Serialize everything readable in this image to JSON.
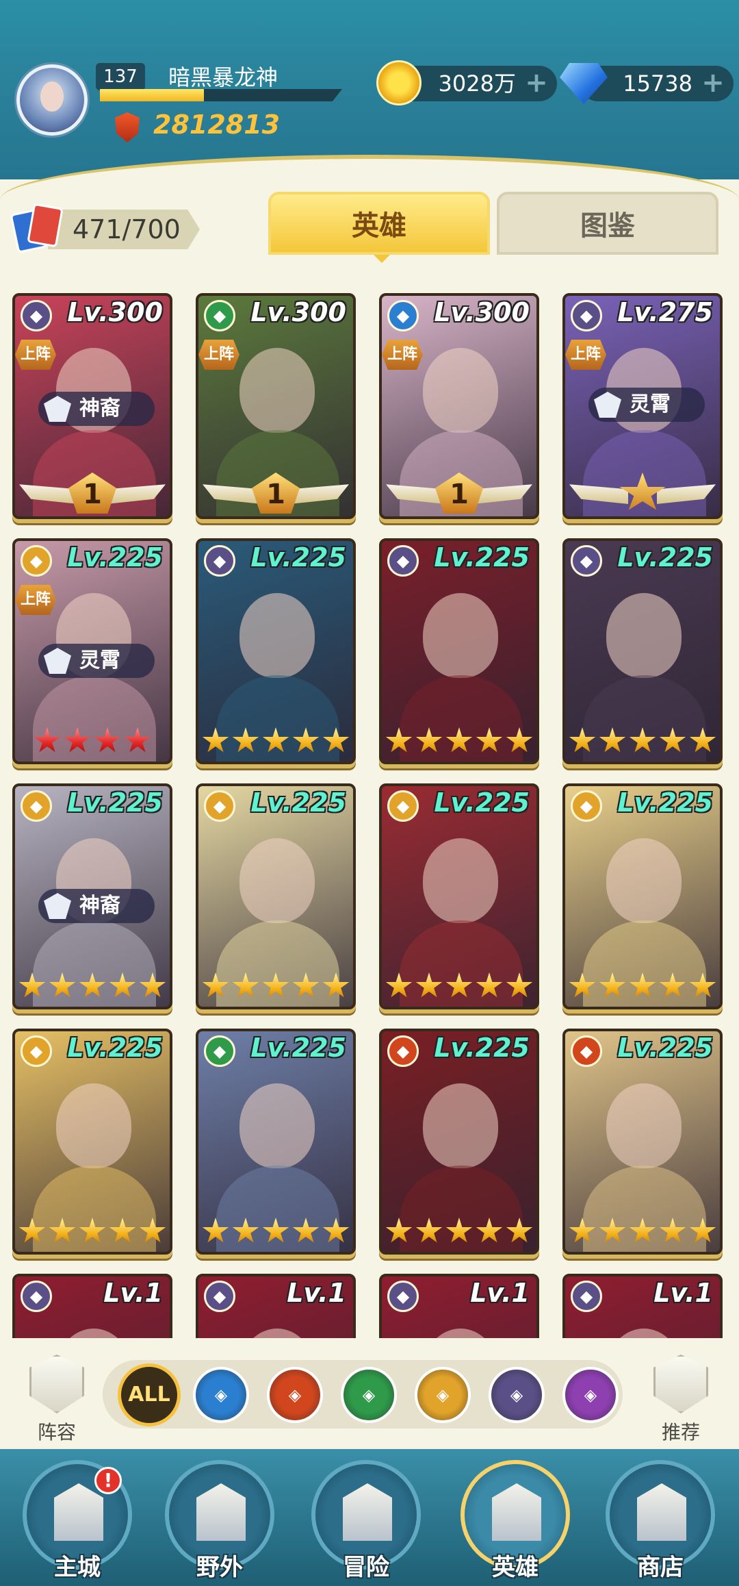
{
  "player": {
    "level": "137",
    "name": "暗黑暴龙神",
    "exp_fraction": 0.43,
    "power": "2812813"
  },
  "resources": {
    "gold": "3028万",
    "gems": "15738",
    "plus": "+"
  },
  "inventory": {
    "count": "471/700"
  },
  "tabs": [
    {
      "label": "英雄",
      "active": true
    },
    {
      "label": "图鉴",
      "active": false
    }
  ],
  "heroes": [
    {
      "level": "Lv.300",
      "faction": "void",
      "deployed": true,
      "tag": "神裔",
      "rank_medal": "1",
      "stars": 0,
      "art": "#c9435a"
    },
    {
      "level": "Lv.300",
      "faction": "forest",
      "deployed": true,
      "tag": "",
      "rank_medal": "1",
      "stars": 0,
      "art": "#5c7a3c"
    },
    {
      "level": "Lv.300",
      "faction": "water",
      "deployed": true,
      "tag": "",
      "rank_medal": "1",
      "stars": 0,
      "art": "#d8b4c8"
    },
    {
      "level": "Lv.275",
      "faction": "void",
      "deployed": true,
      "tag": "灵霄",
      "rank_medal": "★",
      "stars": 0,
      "art": "#7a62b8"
    },
    {
      "level": "Lv.225",
      "faction": "light",
      "deployed": true,
      "tag": "灵霄",
      "rank_medal": "",
      "stars": 4,
      "star_color": "red",
      "art": "#c79aa8"
    },
    {
      "level": "Lv.225",
      "faction": "void",
      "deployed": false,
      "tag": "",
      "rank_medal": "",
      "stars": 5,
      "art": "#2a5b7a"
    },
    {
      "level": "Lv.225",
      "faction": "void",
      "deployed": false,
      "tag": "",
      "rank_medal": "",
      "stars": 5,
      "art": "#7a1f2a"
    },
    {
      "level": "Lv.225",
      "faction": "void",
      "deployed": false,
      "tag": "",
      "rank_medal": "",
      "stars": 5,
      "art": "#4a3a52"
    },
    {
      "level": "Lv.225",
      "faction": "light",
      "deployed": false,
      "tag": "神裔",
      "rank_medal": "",
      "stars": 5,
      "art": "#b7b3c0"
    },
    {
      "level": "Lv.225",
      "faction": "light",
      "deployed": false,
      "tag": "",
      "rank_medal": "",
      "stars": 5,
      "art": "#e4d7a2"
    },
    {
      "level": "Lv.225",
      "faction": "light",
      "deployed": false,
      "tag": "",
      "rank_medal": "",
      "stars": 5,
      "art": "#9a2b32"
    },
    {
      "level": "Lv.225",
      "faction": "light",
      "deployed": false,
      "tag": "",
      "rank_medal": "",
      "stars": 5,
      "art": "#e8cf8a"
    },
    {
      "level": "Lv.225",
      "faction": "light",
      "deployed": false,
      "tag": "",
      "rank_medal": "",
      "stars": 5,
      "art": "#e6c065"
    },
    {
      "level": "Lv.225",
      "faction": "forest",
      "deployed": false,
      "tag": "",
      "rank_medal": "",
      "stars": 5,
      "art": "#6e7fa8"
    },
    {
      "level": "Lv.225",
      "faction": "fire",
      "deployed": false,
      "tag": "",
      "rank_medal": "",
      "stars": 5,
      "art": "#7a1f24"
    },
    {
      "level": "Lv.225",
      "faction": "fire",
      "deployed": false,
      "tag": "",
      "rank_medal": "",
      "stars": 5,
      "art": "#e0c489"
    },
    {
      "level": "Lv.1",
      "faction": "void",
      "deployed": false,
      "tag": "",
      "rank_medal": "",
      "stars": 0,
      "art": "#8f1d30"
    },
    {
      "level": "Lv.1",
      "faction": "void",
      "deployed": false,
      "tag": "",
      "rank_medal": "",
      "stars": 0,
      "art": "#8f1d30"
    },
    {
      "level": "Lv.1",
      "faction": "void",
      "deployed": false,
      "tag": "",
      "rank_medal": "",
      "stars": 0,
      "art": "#8f1d30"
    },
    {
      "level": "Lv.1",
      "faction": "void",
      "deployed": false,
      "tag": "",
      "rank_medal": "",
      "stars": 0,
      "art": "#8f1d30"
    }
  ],
  "deployed_label": "上阵",
  "faction_colors": {
    "void": "#5a4f86",
    "forest": "#2e9a4a",
    "water": "#2a7fd0",
    "light": "#e2a32a",
    "fire": "#d2461e",
    "dark": "#8e3fb0"
  },
  "filters": [
    {
      "id": "all",
      "label": "ALL",
      "active": true,
      "color": "#3b2e18"
    },
    {
      "id": "water",
      "label": "",
      "active": false,
      "color": "#2a7fd0"
    },
    {
      "id": "fire",
      "label": "",
      "active": false,
      "color": "#d2461e"
    },
    {
      "id": "forest",
      "label": "",
      "active": false,
      "color": "#2e9a4a"
    },
    {
      "id": "light",
      "label": "",
      "active": false,
      "color": "#e2a32a"
    },
    {
      "id": "void",
      "label": "",
      "active": false,
      "color": "#5a4f86"
    },
    {
      "id": "dark",
      "label": "",
      "active": false,
      "color": "#8e3fb0"
    }
  ],
  "filter_side": {
    "lineup": "阵容",
    "recommend": "推荐"
  },
  "nav": [
    {
      "label": "主城",
      "active": false,
      "alert": "!"
    },
    {
      "label": "野外",
      "active": false
    },
    {
      "label": "冒险",
      "active": false
    },
    {
      "label": "英雄",
      "active": true
    },
    {
      "label": "商店",
      "active": false
    }
  ]
}
